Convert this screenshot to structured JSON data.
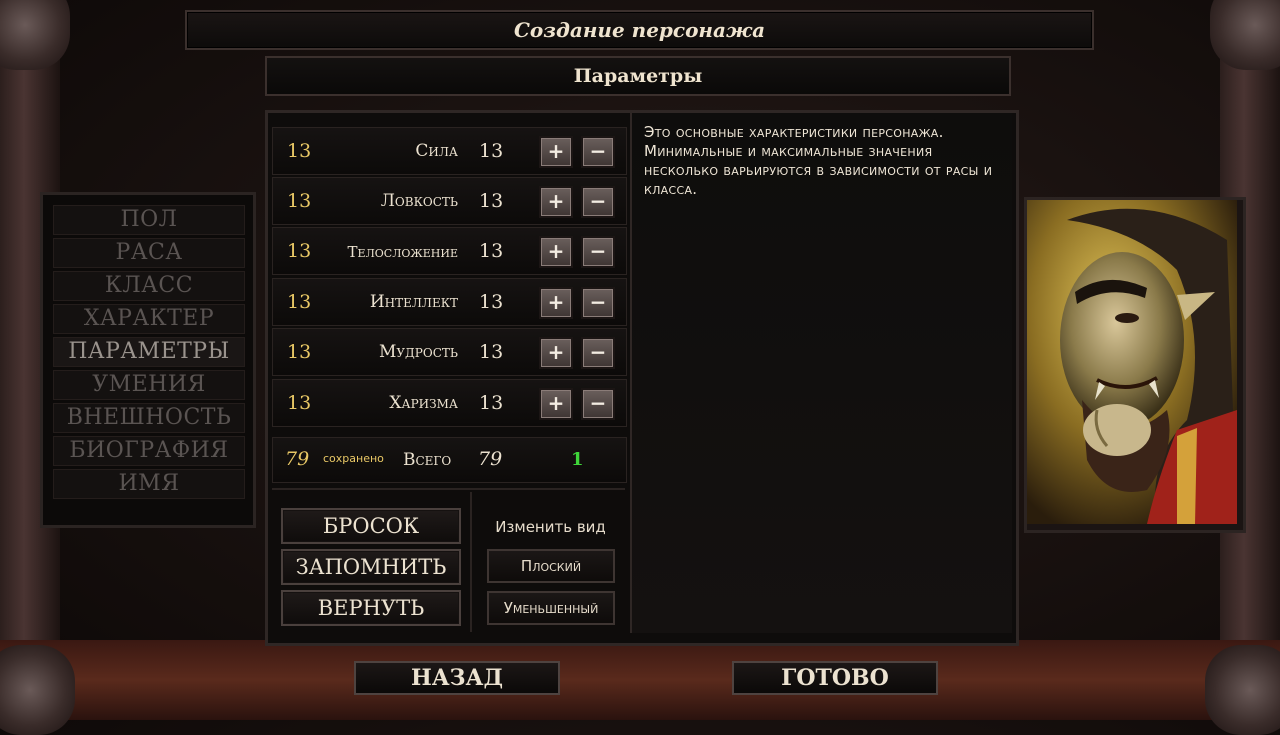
{
  "header": {
    "title": "Создание персонажа",
    "subtitle": "Параметры"
  },
  "description": "Это основные характеристики персонажа. Минимальные и максимальные значения несколько варьируются в зависимости от расы и класса.",
  "stats": [
    {
      "name": "Сила",
      "base": "13",
      "value": "13"
    },
    {
      "name": "Ловкость",
      "base": "13",
      "value": "13"
    },
    {
      "name": "Телосложение",
      "base": "13",
      "value": "13"
    },
    {
      "name": "Интеллект",
      "base": "13",
      "value": "13"
    },
    {
      "name": "Мудрость",
      "base": "13",
      "value": "13"
    },
    {
      "name": "Харизма",
      "base": "13",
      "value": "13"
    }
  ],
  "controls": {
    "plus": "+",
    "minus": "−"
  },
  "total": {
    "saved_value": "79",
    "saved_label": "сохранено",
    "label": "Всего",
    "value": "79",
    "remaining": "1"
  },
  "nav": {
    "items": [
      "ПОЛ",
      "РАСА",
      "КЛАСС",
      "ХАРАКТЕР",
      "ПАРАМЕТРЫ",
      "УМЕНИЯ",
      "ВНЕШНОСТЬ",
      "БИОГРАФИЯ",
      "ИМЯ"
    ],
    "active_index": 4
  },
  "actions": {
    "roll": "БРОСОК",
    "store": "ЗАПОМНИТЬ",
    "recall": "ВЕРНУТЬ"
  },
  "view": {
    "label": "Изменить вид",
    "flat": "Плоский",
    "reduced": "Уменьшенный"
  },
  "footer": {
    "back": "НАЗАД",
    "done": "ГОТОВО"
  },
  "colors": {
    "base_stat": "#e9c866",
    "remaining": "#3fd53a",
    "text": "#ece2d0",
    "inactive_nav": "#5a5452"
  }
}
